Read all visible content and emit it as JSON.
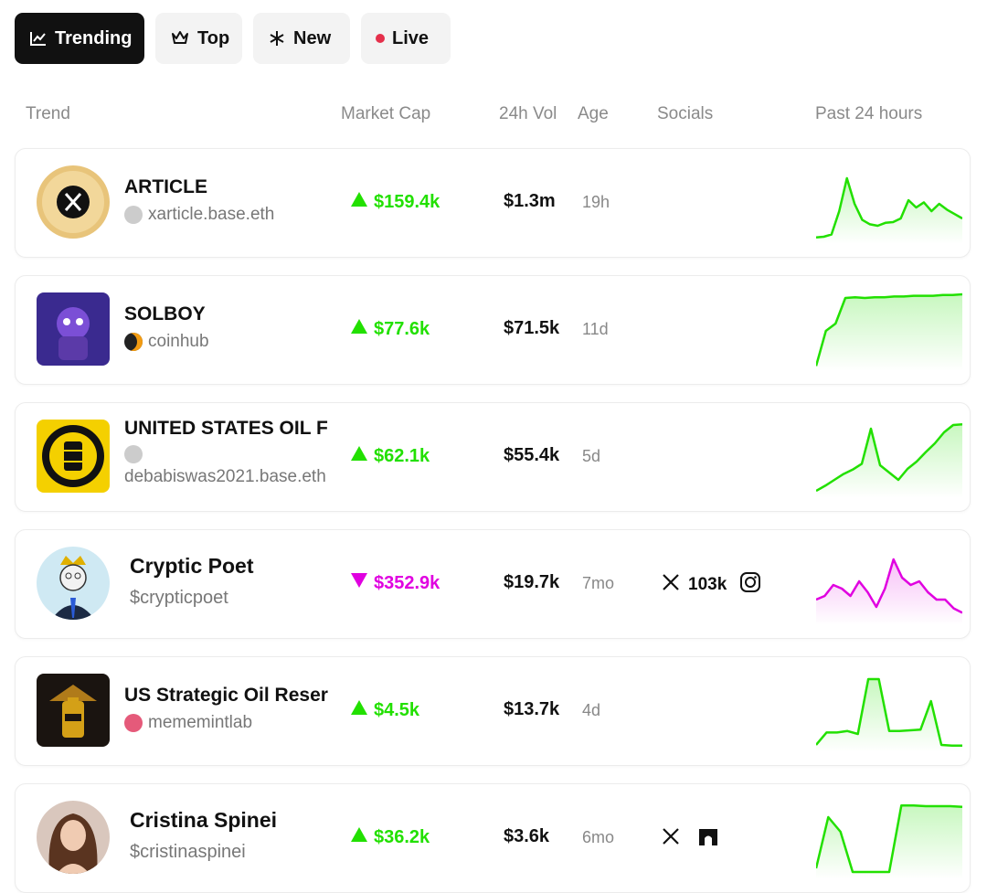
{
  "tabs": [
    {
      "label": "Trending",
      "icon": "chart-line-icon",
      "active": true
    },
    {
      "label": "Top",
      "icon": "crown-icon",
      "active": false
    },
    {
      "label": "New",
      "icon": "asterisk-icon",
      "active": false
    },
    {
      "label": "Live",
      "icon": "live-dot-icon",
      "active": false
    }
  ],
  "columns": {
    "trend": "Trend",
    "market_cap": "Market Cap",
    "vol_24h": "24h Vol",
    "age": "Age",
    "socials": "Socials",
    "past_24h": "Past 24 hours"
  },
  "colors": {
    "up": "#22e000",
    "down": "#e000e0",
    "text": "#111111",
    "muted": "#888888"
  },
  "rows": [
    {
      "name": "ARTICLE",
      "sub": "xarticle.base.eth",
      "sub_icon": "user-placeholder-icon",
      "direction": "up",
      "market_cap": "$159.4k",
      "volume": "$1.3m",
      "age": "19h",
      "socials": [],
      "sparkline": [
        0.04,
        0.05,
        0.08,
        0.4,
        0.85,
        0.5,
        0.28,
        0.22,
        0.2,
        0.24,
        0.25,
        0.3,
        0.55,
        0.45,
        0.52,
        0.4,
        0.5,
        0.42,
        0.36,
        0.3
      ],
      "avatar": "x-logo-avatar"
    },
    {
      "name": "SOLBOY",
      "sub": "coinhub",
      "sub_icon": "coinhub-icon",
      "direction": "up",
      "market_cap": "$77.6k",
      "volume": "$71.5k",
      "age": "11d",
      "socials": [],
      "sparkline": [
        0.02,
        0.5,
        0.6,
        0.95,
        0.96,
        0.95,
        0.96,
        0.96,
        0.97,
        0.97,
        0.98,
        0.98,
        0.98,
        0.99,
        0.99,
        1.0
      ],
      "avatar": "purple-character-avatar"
    },
    {
      "name": "UNITED STATES OIL F",
      "sub": "debabiswas2021.base.eth",
      "sub_icon": "user-placeholder-icon",
      "direction": "up",
      "market_cap": "$62.1k",
      "volume": "$55.4k",
      "age": "5d",
      "socials": [],
      "sparkline": [
        0.05,
        0.12,
        0.2,
        0.28,
        0.34,
        0.42,
        0.9,
        0.4,
        0.3,
        0.2,
        0.35,
        0.45,
        0.58,
        0.7,
        0.85,
        0.95,
        0.96
      ],
      "avatar": "oil-barrel-seal-avatar"
    },
    {
      "name": "Cryptic Poet",
      "sub": "$crypticpoet",
      "sub_icon": "",
      "direction": "down",
      "market_cap": "$352.9k",
      "volume": "$19.7k",
      "age": "7mo",
      "socials": [
        {
          "icon": "x-icon",
          "text": "103k"
        },
        {
          "icon": "instagram-icon",
          "text": ""
        }
      ],
      "sparkline": [
        0.3,
        0.35,
        0.5,
        0.45,
        0.35,
        0.55,
        0.4,
        0.2,
        0.45,
        0.85,
        0.6,
        0.5,
        0.55,
        0.4,
        0.3,
        0.3,
        0.18,
        0.12
      ],
      "avatar": "cryptic-poet-avatar"
    },
    {
      "name": "US Strategic Oil Reser",
      "sub": "mememintlab",
      "sub_icon": "mememintlab-icon",
      "direction": "up",
      "market_cap": "$4.5k",
      "volume": "$13.7k",
      "age": "4d",
      "socials": [],
      "sparkline": [
        0.05,
        0.22,
        0.22,
        0.24,
        0.2,
        0.95,
        0.95,
        0.24,
        0.24,
        0.25,
        0.26,
        0.65,
        0.05,
        0.04,
        0.04
      ],
      "avatar": "oil-battery-avatar"
    },
    {
      "name": "Cristina Spinei",
      "sub": "$cristinaspinei",
      "sub_icon": "",
      "direction": "up",
      "market_cap": "$36.2k",
      "volume": "$3.6k",
      "age": "6mo",
      "socials": [
        {
          "icon": "x-icon",
          "text": ""
        },
        {
          "icon": "arch-icon",
          "text": ""
        }
      ],
      "sparkline": [
        0.1,
        0.8,
        0.6,
        0.05,
        0.05,
        0.05,
        0.05,
        0.96,
        0.96,
        0.95,
        0.95,
        0.95,
        0.94
      ],
      "avatar": "cristina-photo-avatar"
    }
  ]
}
